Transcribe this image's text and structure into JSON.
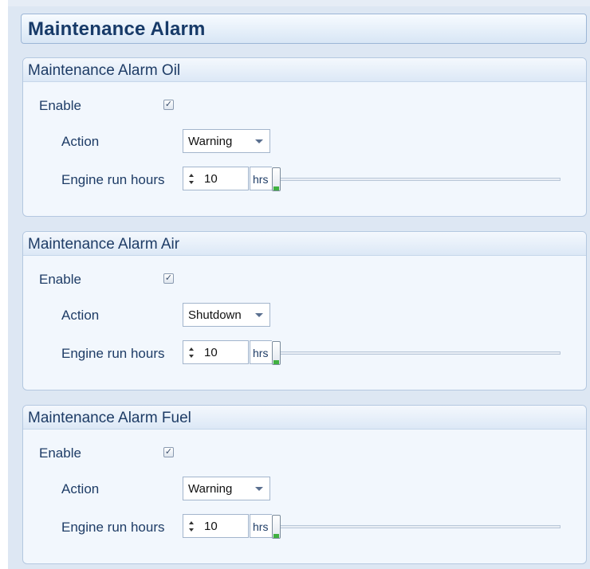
{
  "header": {
    "title": "Maintenance Alarm"
  },
  "groups": [
    {
      "title": "Maintenance Alarm Oil",
      "enable_label": "Enable",
      "enabled": true,
      "check_glyph": "✓",
      "action_label": "Action",
      "action_value": "Warning",
      "hours_label": "Engine run hours",
      "hours_value": "10",
      "hours_unit": "hrs",
      "slider_level": 0.0
    },
    {
      "title": "Maintenance Alarm Air",
      "enable_label": "Enable",
      "enabled": true,
      "check_glyph": "✓",
      "action_label": "Action",
      "action_value": "Shutdown",
      "hours_label": "Engine run hours",
      "hours_value": "10",
      "hours_unit": "hrs",
      "slider_level": 0.0
    },
    {
      "title": "Maintenance Alarm Fuel",
      "enable_label": "Enable",
      "enabled": true,
      "check_glyph": "✓",
      "action_label": "Action",
      "action_value": "Warning",
      "hours_label": "Engine run hours",
      "hours_value": "10",
      "hours_unit": "hrs",
      "slider_level": 0.0
    }
  ],
  "colors": {
    "accent": "#173a68",
    "panel_background": "#f2f7fd",
    "slider_thumb_accent": "#40b040"
  }
}
